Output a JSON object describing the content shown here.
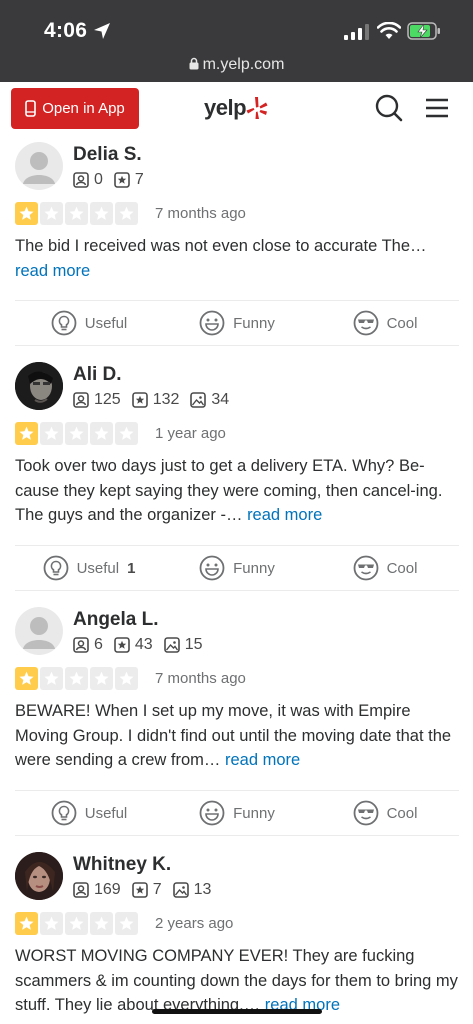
{
  "status_bar": {
    "time": "4:06",
    "url": "m.yelp.com"
  },
  "header": {
    "open_app_label": "Open in App",
    "logo_text": "yelp"
  },
  "reviews": [
    {
      "name": "Delia S.",
      "stats": {
        "friends": "0",
        "reviews": "7"
      },
      "rating": 1,
      "date": "7 months ago",
      "text": "The bid I received was not even close to accurate The…",
      "read_more": "read more",
      "actions": {
        "useful": "Useful",
        "funny": "Funny",
        "cool": "Cool"
      }
    },
    {
      "name": "Ali D.",
      "stats": {
        "friends": "125",
        "reviews": "132",
        "photos": "34"
      },
      "rating": 1,
      "date": "1 year ago",
      "text": "Took over two days just to get a delivery ETA. Why? Be-cause they kept saying they were coming, then cancel-ing. The guys and the organizer -…",
      "read_more": "read more",
      "actions": {
        "useful": "Useful",
        "useful_count": "1",
        "funny": "Funny",
        "cool": "Cool"
      }
    },
    {
      "name": "Angela L.",
      "stats": {
        "friends": "6",
        "reviews": "43",
        "photos": "15"
      },
      "rating": 1,
      "date": "7 months ago",
      "text": "BEWARE! When I set up my move, it was with Empire Moving Group. I didn't find out until the moving date that the were sending a crew from…",
      "read_more": "read more",
      "actions": {
        "useful": "Useful",
        "funny": "Funny",
        "cool": "Cool"
      }
    },
    {
      "name": "Whitney K.",
      "stats": {
        "friends": "169",
        "reviews": "7",
        "photos": "13"
      },
      "rating": 1,
      "date": "2 years ago",
      "text": "WORST MOVING COMPANY EVER! They are fucking scammers & im counting down the days for them to bring my stuff. They lie about everything,…",
      "read_more": "read more"
    }
  ],
  "colors": {
    "brand_red": "#d32323",
    "star_on": "#ffcc4b",
    "link": "#0073bb",
    "status_bar": "#3a3a3c"
  }
}
